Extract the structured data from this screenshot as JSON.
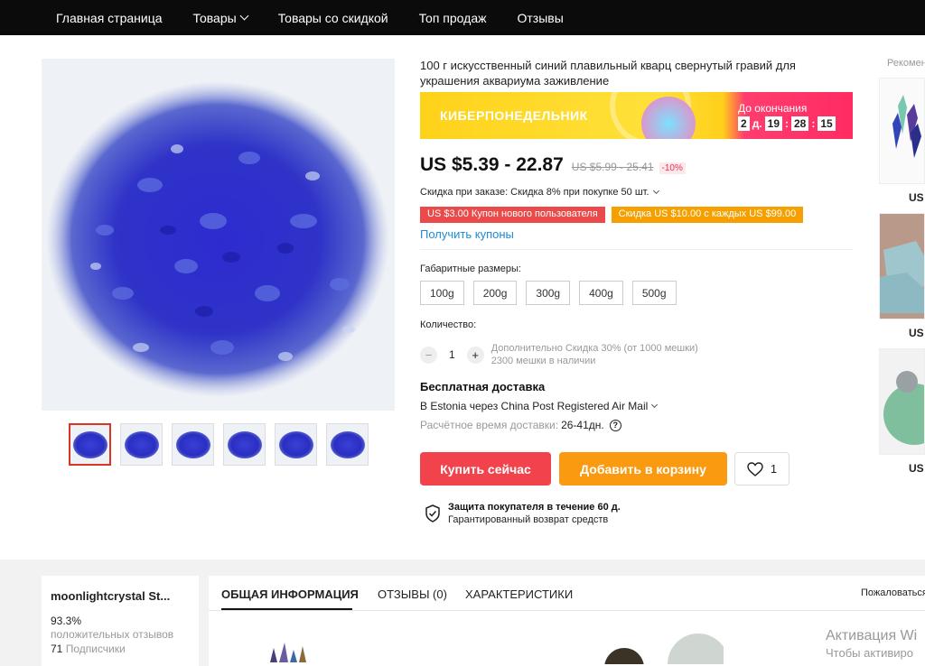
{
  "nav": {
    "items": [
      "Главная страница",
      "Товары",
      "Товары со скидкой",
      "Топ продаж",
      "Отзывы"
    ]
  },
  "product": {
    "title": "100 г искусственный синий плавильный кварц свернутый гравий для украшения аквариума заживление",
    "thumbnail_count": 6
  },
  "banner": {
    "name": "КИБЕРПОНЕДЕЛЬНИК",
    "until_label": "До окончания",
    "days": "2",
    "days_unit": "д.",
    "hours": "19",
    "minutes": "28",
    "seconds": "15"
  },
  "price": {
    "current": "US $5.39 - 22.87",
    "old": "US $5.99 - 25.41",
    "discount": "-10%"
  },
  "bulk_discount": "Скидка при заказе: Скидка 8% при покупке 50 шт.",
  "coupons": {
    "new_user": "US $3.00 Купон нового пользователя",
    "every": "Скидка US $10.00 с каждых US $99.00",
    "get_link": "Получить купоны"
  },
  "size_label": "Габаритные размеры:",
  "sizes": [
    "100g",
    "200g",
    "300g",
    "400g",
    "500g"
  ],
  "quantity": {
    "label": "Количество:",
    "minus": "−",
    "plus": "+",
    "value": "1",
    "info1": "Дополнительно Скидка 30% (от 1000 мешки)",
    "info2": "2300 мешки в наличии"
  },
  "shipping": {
    "title": "Бесплатная доставка",
    "via": "В Estonia через China Post Registered Air Mail",
    "eta_label": "Расчётное время доставки:",
    "eta_value": "26-41дн.",
    "help": "?"
  },
  "buttons": {
    "buy": "Купить сейчас",
    "cart": "Добавить в корзину",
    "wish_count": "1"
  },
  "protection": {
    "title": "Защита покупателя в течение 60 д.",
    "subtitle": "Гарантированный возврат средств"
  },
  "recommend": {
    "title": "Рекомендуем",
    "price_prefix": "US $"
  },
  "store": {
    "name": "moonlightcrystal St...",
    "positive_pct": "93.3%",
    "positive_label": "положительных отзывов",
    "followers": "71",
    "followers_label": "Подписчики"
  },
  "tabs": {
    "overview": "ОБЩАЯ ИНФОРМАЦИЯ",
    "reviews": "ОТЗЫВЫ (0)",
    "specs": "ХАРАКТЕРИСТИКИ",
    "report": "Пожаловаться"
  },
  "activation": {
    "line1": "Активация Wi",
    "line2": "Чтобы активиро"
  },
  "colors": {
    "accent_red": "#f2434d",
    "accent_orange": "#fa9a10",
    "link_blue": "#1d8bd6"
  }
}
